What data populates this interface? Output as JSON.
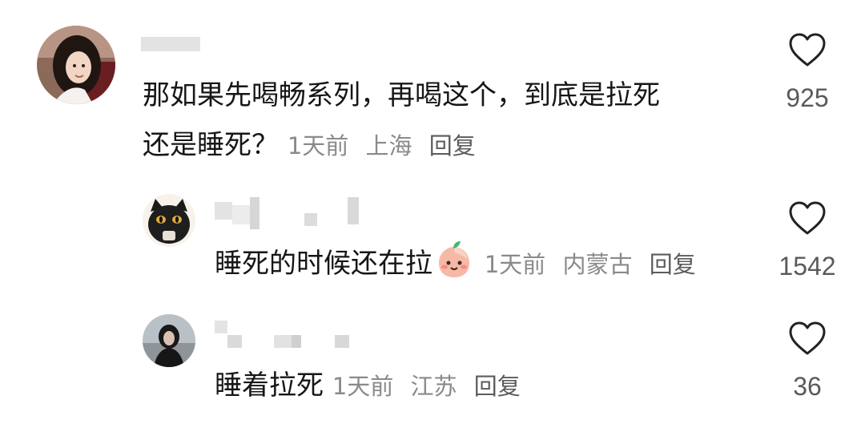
{
  "comments": [
    {
      "text_line1": "那如果先喝畅系列，再喝这个，到底是拉死",
      "text_line2": "还是睡死？",
      "time": "1天前",
      "location": "上海",
      "reply": "回复",
      "likes": "925",
      "avatar_icon": "avatar-woman-photo"
    },
    {
      "text": "睡死的时候还在拉",
      "emoji": "smiling-peach-emoji",
      "time": "1天前",
      "location": "内蒙古",
      "reply": "回复",
      "likes": "1542",
      "avatar_icon": "avatar-black-cat"
    },
    {
      "text": "睡着拉死",
      "time": "1天前",
      "location": "江苏",
      "reply": "回复",
      "likes": "36",
      "avatar_icon": "avatar-woman-beach-photo"
    }
  ]
}
